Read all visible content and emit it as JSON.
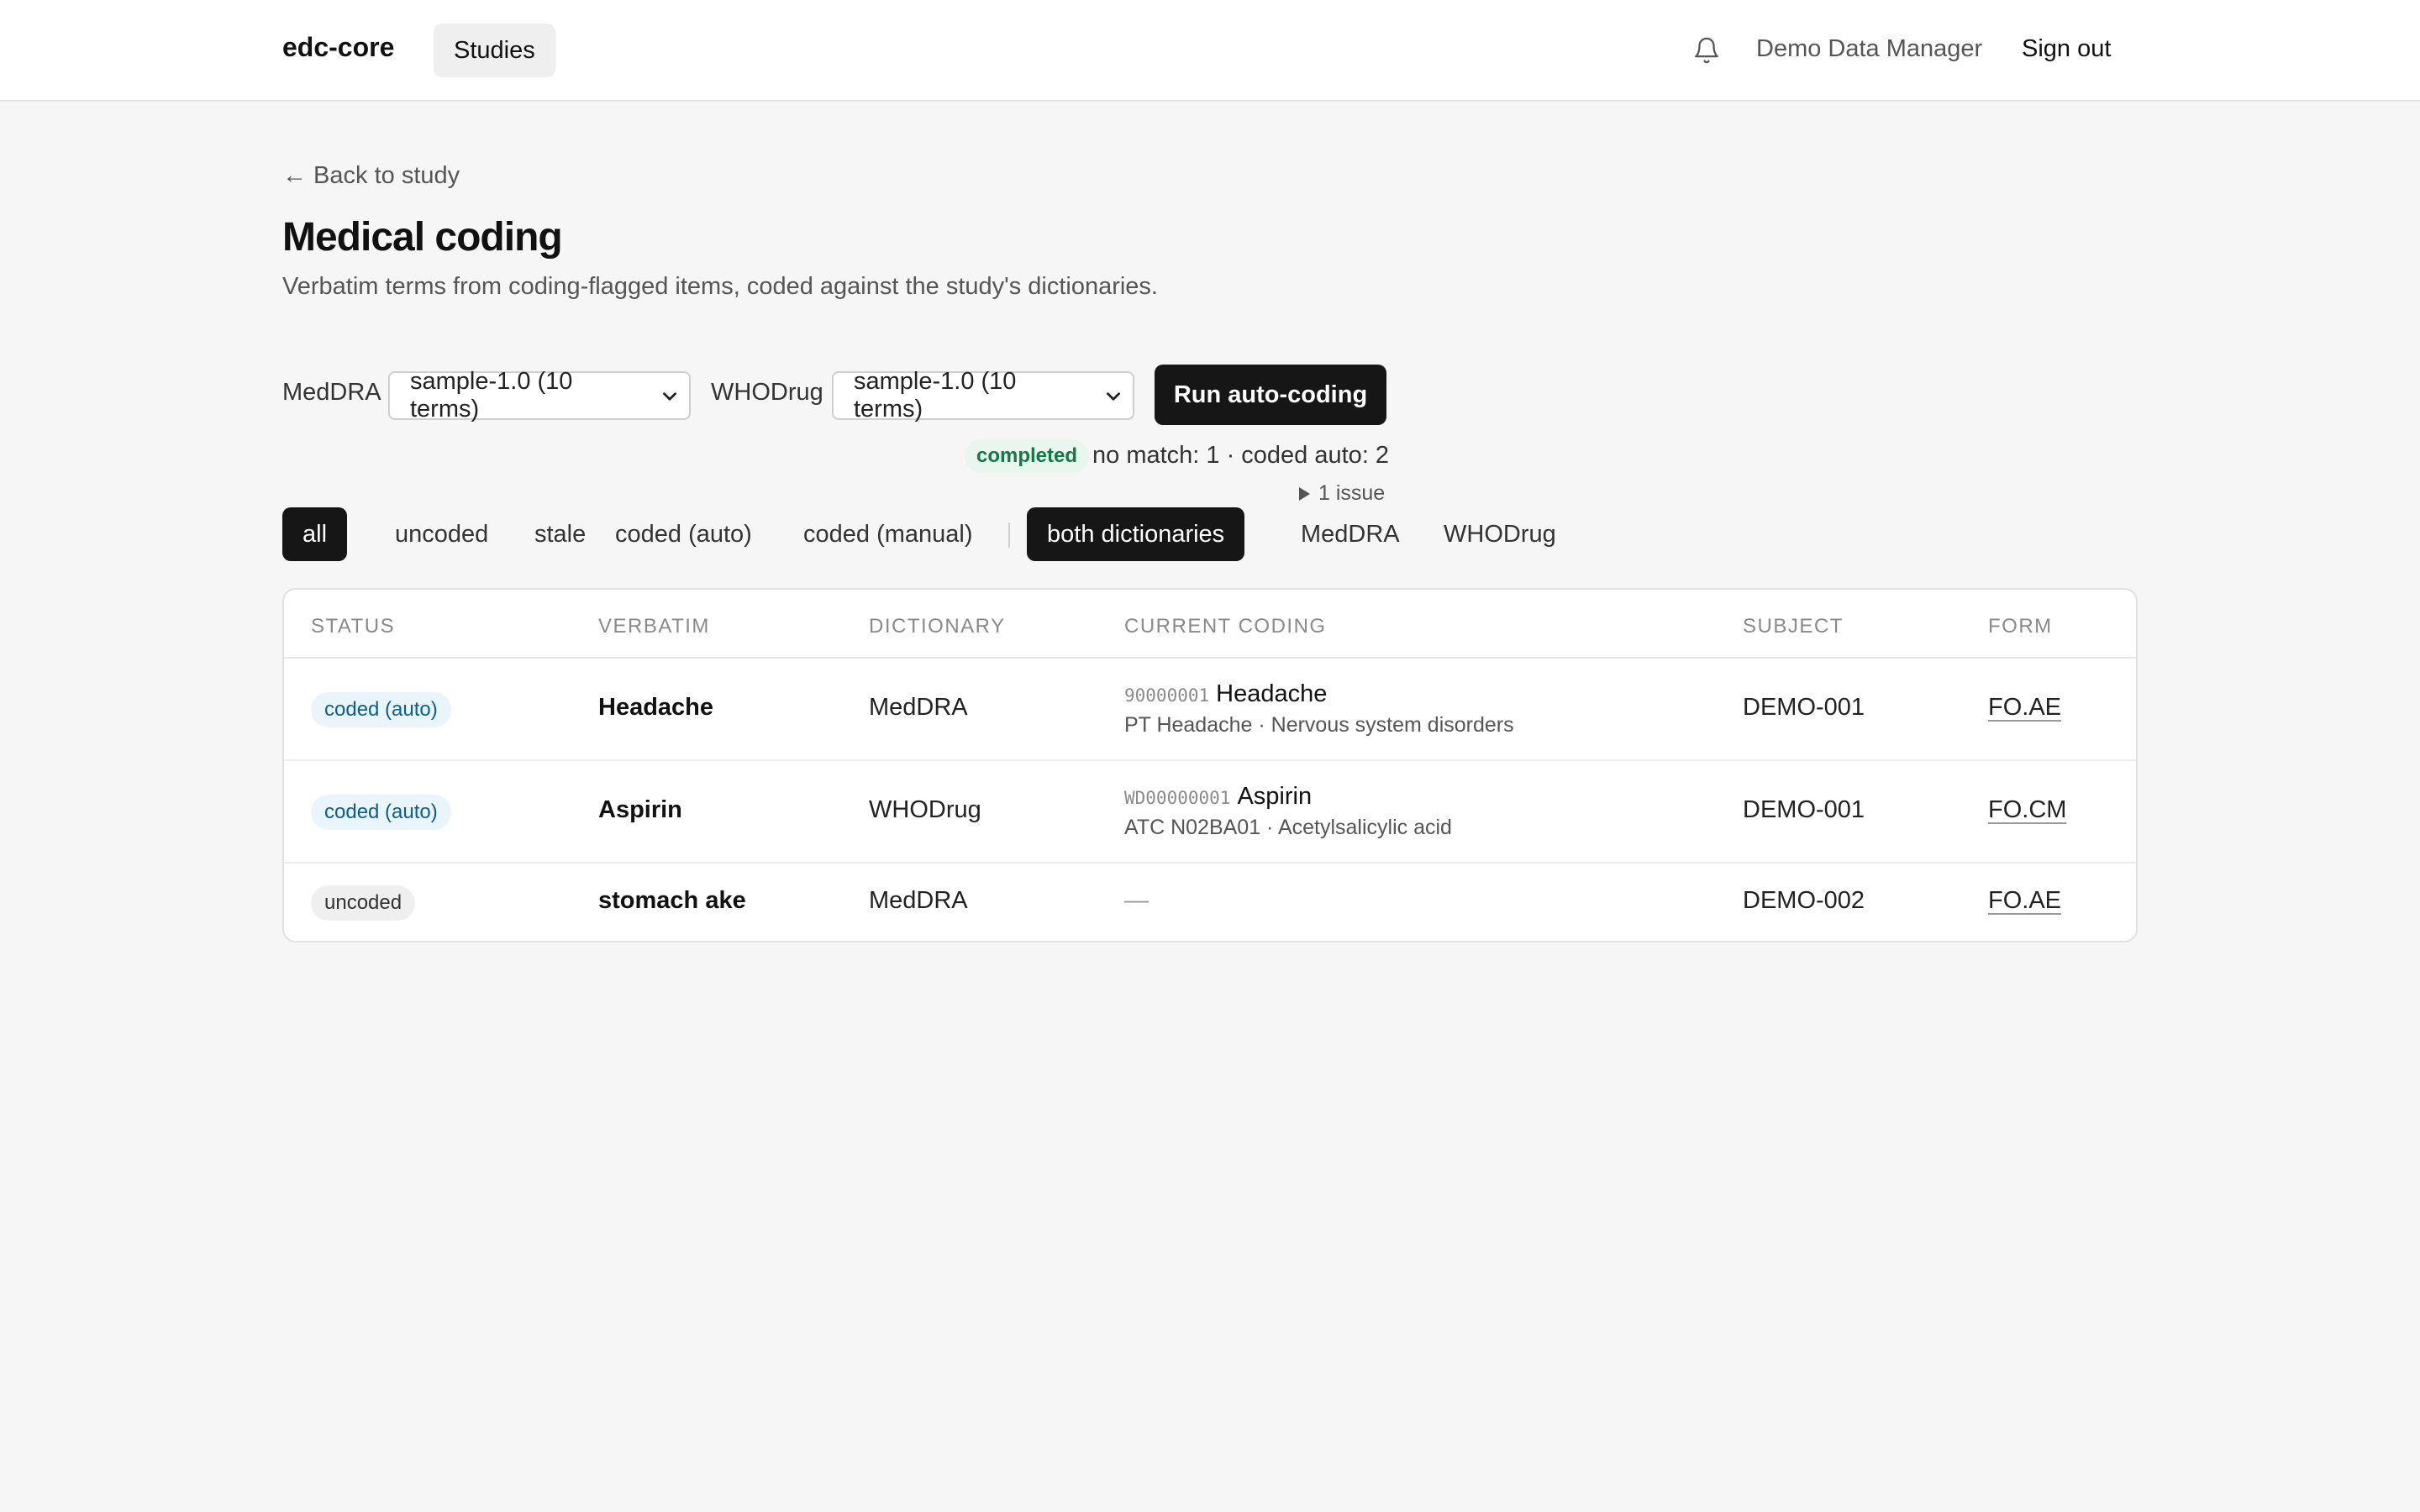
{
  "header": {
    "brand": "edc-core",
    "nav_studies": "Studies",
    "bell_icon": "bell-icon",
    "user_name": "Demo Data Manager",
    "sign_out": "Sign out"
  },
  "page": {
    "back_link": "← Back to study",
    "title": "Medical coding",
    "subtitle": "Verbatim terms from coding-flagged items, coded against the study's dictionaries."
  },
  "dictionaries": {
    "meddra_label": "MedDRA",
    "meddra_selected": "sample-1.0 (10 terms)",
    "whodrug_label": "WHODrug",
    "whodrug_selected": "sample-1.0 (10 terms)"
  },
  "run": {
    "button_label": "Run auto-coding",
    "status": "completed",
    "summary": "no match: 1 · coded auto: 2",
    "issues_toggle": "1 issue"
  },
  "status_filters": [
    {
      "label": "all",
      "active": true
    },
    {
      "label": "uncoded",
      "active": false
    },
    {
      "label": "stale",
      "active": false
    },
    {
      "label": "coded (auto)",
      "active": false
    },
    {
      "label": "coded (manual)",
      "active": false
    }
  ],
  "separator": "|",
  "dictionary_filters": [
    {
      "label": "both dictionaries",
      "active": true
    },
    {
      "label": "MedDRA",
      "active": false
    },
    {
      "label": "WHODrug",
      "active": false
    }
  ],
  "table": {
    "headers": [
      "STATUS",
      "VERBATIM",
      "DICTIONARY",
      "CURRENT CODING",
      "SUBJECT",
      "FORM"
    ],
    "rows": [
      {
        "status": "coded (auto)",
        "verbatim": "Headache",
        "dictionary": "MedDRA",
        "code_id": "90000001",
        "code_term": "Headache",
        "code_detail": "PT Headache · Nervous system disorders",
        "subject": "DEMO-001",
        "form": "FO.AE"
      },
      {
        "status": "coded (auto)",
        "verbatim": "Aspirin",
        "dictionary": "WHODrug",
        "code_id": "WD00000001",
        "code_term": "Aspirin",
        "code_detail": "ATC N02BA01 · Acetylsalicylic acid",
        "subject": "DEMO-001",
        "form": "FO.CM"
      },
      {
        "status": "uncoded",
        "verbatim": "stomach ake",
        "dictionary": "MedDRA",
        "code_empty": "—",
        "subject": "DEMO-002",
        "form": "FO.AE"
      }
    ]
  }
}
